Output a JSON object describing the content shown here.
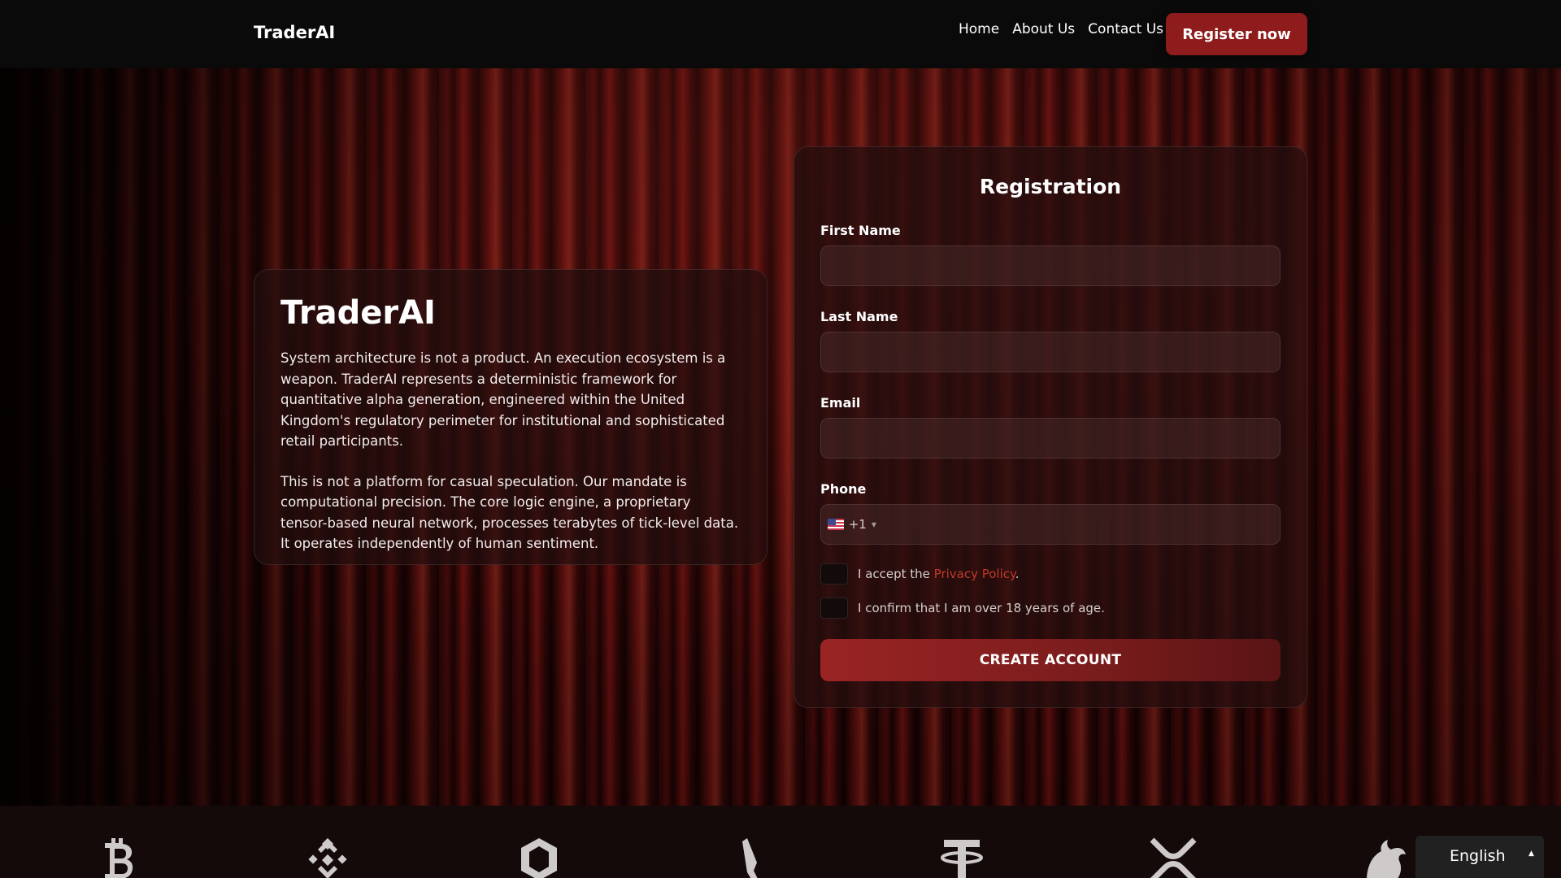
{
  "header": {
    "brand": "TraderAI",
    "nav": [
      {
        "label": "Home"
      },
      {
        "label": "About Us"
      },
      {
        "label": "Contact Us"
      }
    ],
    "register_label": "Register now"
  },
  "about": {
    "title": "TraderAI",
    "paragraphs": [
      "System architecture is not a product. An execution ecosystem is a weapon. TraderAI represents a deterministic framework for quantitative alpha generation, engineered within the United Kingdom's regulatory perimeter for institutional and sophisticated retail participants.",
      "This is not a platform for casual speculation. Our mandate is computational precision. The core logic engine, a proprietary tensor-based neural network, processes terabytes of tick-level data. It operates independently of human sentiment."
    ]
  },
  "registration": {
    "title": "Registration",
    "fields": {
      "first_name": {
        "label": "First Name",
        "value": ""
      },
      "last_name": {
        "label": "Last Name",
        "value": ""
      },
      "email": {
        "label": "Email",
        "value": ""
      },
      "phone": {
        "label": "Phone",
        "country_icon": "us-flag-icon",
        "dial_code": "+1",
        "value": ""
      }
    },
    "privacy": {
      "prefix": "I accept the ",
      "link": "Privacy Policy",
      "suffix": "."
    },
    "age_confirm": "I confirm that I am over 18 years of age.",
    "submit_label": "CREATE ACCOUNT"
  },
  "crypto_icons": [
    "bitcoin-icon",
    "binance-icon",
    "chainlink-icon",
    "solana-icon",
    "tether-icon",
    "xrp-icon",
    "uniswap-icon"
  ],
  "language": {
    "label": "English"
  },
  "colors": {
    "accent": "#8f1c1c",
    "link": "#c0392b",
    "header_bg": "#0b0a0a"
  }
}
